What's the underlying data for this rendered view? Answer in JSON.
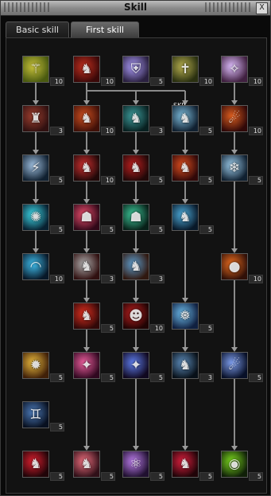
{
  "window": {
    "title": "Skill",
    "close_label": "X"
  },
  "tabs": [
    {
      "label": "Basic skill",
      "active": false
    },
    {
      "label": "First skill",
      "active": true
    }
  ],
  "overlay_text": "SKP",
  "rows": [
    [
      {
        "level": "10",
        "icon": "staff-icon",
        "glyph": "⚚",
        "colors": [
          "#c8c23a",
          "#4a5a10"
        ]
      },
      {
        "level": "10",
        "icon": "red-dragon-icon",
        "glyph": "♞",
        "colors": [
          "#c43020",
          "#3a0808"
        ]
      },
      {
        "level": "5",
        "icon": "knight-shield-icon",
        "glyph": "⛨",
        "colors": [
          "#b0a0ff",
          "#2a2040"
        ]
      },
      {
        "level": "10",
        "icon": "holy-cross-icon",
        "glyph": "✝",
        "colors": [
          "#b8b050",
          "#2a3010"
        ]
      },
      {
        "level": "10",
        "icon": "light-ray-icon",
        "glyph": "✧",
        "colors": [
          "#e0c0ff",
          "#402040"
        ]
      }
    ],
    [
      {
        "level": "3",
        "icon": "demon-beast-icon",
        "glyph": "♜",
        "colors": [
          "#a04030",
          "#301010"
        ]
      },
      {
        "level": "10",
        "icon": "fire-beast-icon",
        "glyph": "♞",
        "colors": [
          "#d05020",
          "#401008"
        ]
      },
      {
        "level": "3",
        "icon": "teal-dragon-icon",
        "glyph": "♞",
        "colors": [
          "#40a0a0",
          "#082020"
        ]
      },
      {
        "level": "5",
        "icon": "ice-dragon-icon",
        "glyph": "♞",
        "colors": [
          "#80c0e0",
          "#102030"
        ]
      },
      {
        "level": "10",
        "icon": "flame-claw-icon",
        "glyph": "☄",
        "colors": [
          "#e06020",
          "#300808"
        ]
      }
    ],
    [
      {
        "level": "5",
        "icon": "storm-arrows-icon",
        "glyph": "⚡",
        "colors": [
          "#a0c0e0",
          "#102030"
        ]
      },
      {
        "level": "10",
        "icon": "red-wolf-icon",
        "glyph": "♞",
        "colors": [
          "#d03030",
          "#200808"
        ]
      },
      {
        "level": "5",
        "icon": "blood-dragon-icon",
        "glyph": "♞",
        "colors": [
          "#c02020",
          "#200808"
        ]
      },
      {
        "level": "5",
        "icon": "inferno-dragon-icon",
        "glyph": "♞",
        "colors": [
          "#e05020",
          "#300808"
        ]
      },
      {
        "level": "5",
        "icon": "frost-beast-icon",
        "glyph": "❄",
        "colors": [
          "#a0d0f0",
          "#102030"
        ]
      }
    ],
    [
      {
        "level": "5",
        "icon": "cyan-rune-icon",
        "glyph": "✺",
        "colors": [
          "#40e0f0",
          "#082030"
        ]
      },
      {
        "level": "5",
        "icon": "red-aura-icon",
        "glyph": "☗",
        "colors": [
          "#f05070",
          "#300818"
        ]
      },
      {
        "level": "5",
        "icon": "green-spirit-icon",
        "glyph": "☗",
        "colors": [
          "#40d0a0",
          "#082018"
        ]
      },
      {
        "level": "5",
        "icon": "water-dragon-icon",
        "glyph": "♞",
        "colors": [
          "#50b0e0",
          "#081828"
        ]
      },
      null
    ],
    [
      {
        "level": "10",
        "icon": "wave-slash-icon",
        "glyph": "◠",
        "colors": [
          "#40c0f0",
          "#081828"
        ]
      },
      {
        "level": "3",
        "icon": "grey-dragon-icon",
        "glyph": "♞",
        "colors": [
          "#b0b0b0",
          "#301010"
        ]
      },
      {
        "level": "3",
        "icon": "blue-beast-icon",
        "glyph": "♞",
        "colors": [
          "#60a0d0",
          "#301810"
        ]
      },
      null,
      {
        "level": "10",
        "icon": "fire-orb-icon",
        "glyph": "●",
        "colors": [
          "#f07020",
          "#301008"
        ]
      }
    ],
    [
      null,
      {
        "level": "5",
        "icon": "crimson-dragon-icon",
        "glyph": "♞",
        "colors": [
          "#e03020",
          "#300808"
        ]
      },
      {
        "level": "10",
        "icon": "demon-mask-icon",
        "glyph": "☻",
        "colors": [
          "#c02020",
          "#200404"
        ]
      },
      {
        "level": "5",
        "icon": "ice-shard-icon",
        "glyph": "❅",
        "colors": [
          "#70c0f0",
          "#102040"
        ]
      },
      null
    ],
    [
      {
        "level": "5",
        "icon": "golden-sigil-icon",
        "glyph": "✹",
        "colors": [
          "#f0c040",
          "#402008"
        ]
      },
      {
        "level": "5",
        "icon": "pink-claw-icon",
        "glyph": "✦",
        "colors": [
          "#f060a0",
          "#300820"
        ]
      },
      {
        "level": "5",
        "icon": "blue-claw-icon",
        "glyph": "✦",
        "colors": [
          "#6080f0",
          "#100820"
        ]
      },
      {
        "level": "3",
        "icon": "dark-dragon-icon",
        "glyph": "♞",
        "colors": [
          "#6090c0",
          "#081018"
        ]
      },
      {
        "level": "5",
        "icon": "comet-icon",
        "glyph": "☄",
        "colors": [
          "#80a0f0",
          "#081028"
        ]
      }
    ],
    [
      {
        "level": "5",
        "icon": "twin-spirit-icon",
        "glyph": "♊",
        "colors": [
          "#5080c0",
          "#081020"
        ]
      },
      null,
      null,
      null,
      null
    ],
    [
      {
        "level": "5",
        "icon": "red-fiend-icon",
        "glyph": "♞",
        "colors": [
          "#e02030",
          "#200408"
        ]
      },
      {
        "level": "5",
        "icon": "rose-dragon-icon",
        "glyph": "♞",
        "colors": [
          "#f07080",
          "#301018"
        ]
      },
      {
        "level": "5",
        "icon": "atom-orb-icon",
        "glyph": "⚛",
        "colors": [
          "#c080f0",
          "#201030"
        ]
      },
      {
        "level": "5",
        "icon": "scarlet-beast-icon",
        "glyph": "♞",
        "colors": [
          "#e02040",
          "#200408"
        ]
      },
      {
        "level": "5",
        "icon": "green-orb-icon",
        "glyph": "◉",
        "colors": [
          "#80e020",
          "#102008"
        ]
      }
    ]
  ],
  "connections": [
    [
      0,
      0,
      1,
      0
    ],
    [
      1,
      0,
      2,
      0
    ],
    [
      2,
      0,
      3,
      0
    ],
    [
      3,
      0,
      4,
      0
    ],
    [
      0,
      1,
      1,
      1
    ],
    [
      1,
      1,
      2,
      1
    ],
    [
      2,
      1,
      3,
      1
    ],
    [
      3,
      1,
      4,
      1
    ],
    [
      4,
      1,
      5,
      1
    ],
    [
      5,
      1,
      6,
      1
    ],
    [
      6,
      1,
      8,
      1
    ],
    [
      0,
      1,
      1,
      2
    ],
    [
      1,
      2,
      2,
      2
    ],
    [
      2,
      2,
      3,
      2
    ],
    [
      3,
      2,
      4,
      2
    ],
    [
      4,
      2,
      5,
      2
    ],
    [
      5,
      2,
      6,
      2
    ],
    [
      6,
      2,
      8,
      2
    ],
    [
      0,
      1,
      1,
      3
    ],
    [
      1,
      3,
      2,
      3
    ],
    [
      2,
      3,
      3,
      3
    ],
    [
      3,
      3,
      5,
      3
    ],
    [
      5,
      3,
      6,
      3
    ],
    [
      6,
      3,
      8,
      3
    ],
    [
      0,
      4,
      1,
      4
    ],
    [
      1,
      4,
      2,
      4
    ],
    [
      2,
      4,
      4,
      4
    ],
    [
      4,
      4,
      6,
      4
    ],
    [
      6,
      4,
      8,
      4
    ]
  ]
}
